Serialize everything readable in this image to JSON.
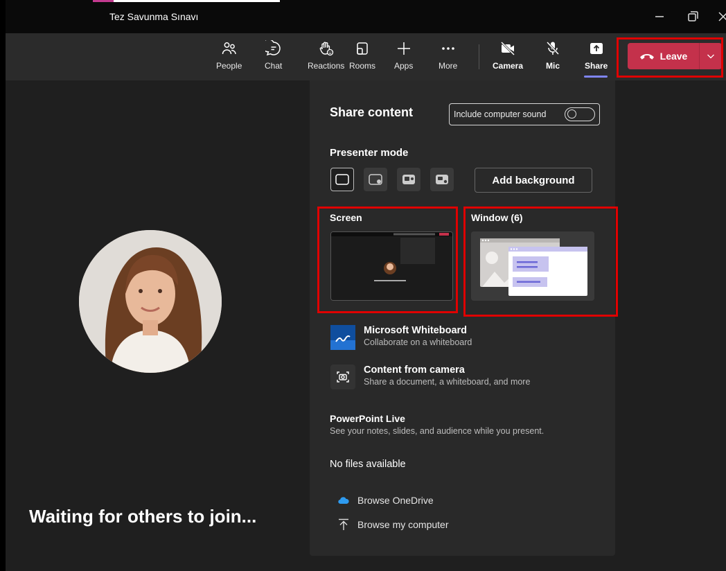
{
  "window": {
    "title": "Tez Savunma Sınavı"
  },
  "toolbar": {
    "people": "People",
    "chat": "Chat",
    "reactions": "Reactions",
    "rooms": "Rooms",
    "apps": "Apps",
    "more": "More",
    "camera": "Camera",
    "mic": "Mic",
    "share": "Share",
    "leave": "Leave"
  },
  "stage": {
    "waiting_text": "Waiting for others to join..."
  },
  "share_panel": {
    "title": "Share content",
    "include_sound": "Include computer sound",
    "presenter_mode": "Presenter mode",
    "add_background": "Add background",
    "screen": "Screen",
    "window": "Window (6)",
    "thumb_waiting": "Waiting for others to join...",
    "whiteboard_title": "Microsoft Whiteboard",
    "whiteboard_sub": "Collaborate on a whiteboard",
    "camera_title": "Content from camera",
    "camera_sub": "Share a document, a whiteboard, and more",
    "ppt_title": "PowerPoint Live",
    "ppt_sub": "See your notes, slides, and audience while you present.",
    "no_files": "No files available",
    "browse_onedrive": "Browse OneDrive",
    "browse_computer": "Browse my computer"
  },
  "colors": {
    "leave": "#c4314b",
    "accent": "#7f85f5",
    "highlight": "#e00000"
  }
}
